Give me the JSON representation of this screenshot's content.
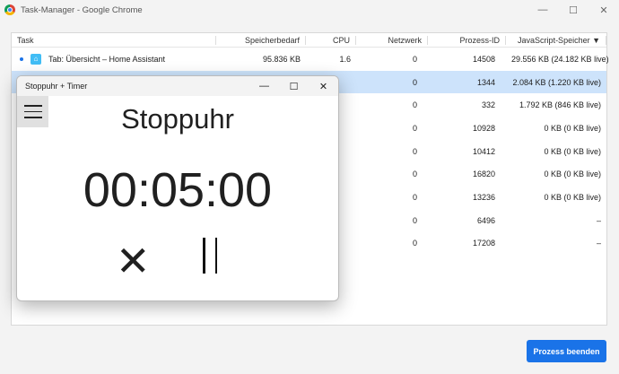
{
  "window": {
    "title": "Task-Manager - Google Chrome",
    "minimize": "—",
    "maximize": "☐",
    "close": "✕"
  },
  "columns": [
    "Task",
    "Speicherbedarf",
    "CPU",
    "Netzwerk",
    "Prozess-ID",
    "JavaScript-Speicher ▼"
  ],
  "rows": [
    {
      "task": "Tab: Übersicht – Home Assistant",
      "mem": "95.836 KB",
      "cpu": "1.6",
      "net": "0",
      "pid": "14508",
      "js": "29.556 KB (24.182 KB live)"
    },
    {
      "task": "",
      "mem": "",
      "cpu": "",
      "net": "0",
      "pid": "1344",
      "js": "2.084 KB (1.220 KB live)"
    },
    {
      "task": "",
      "mem": "",
      "cpu": "",
      "net": "0",
      "pid": "332",
      "js": "1.792 KB (846 KB live)"
    },
    {
      "task": "",
      "mem": "",
      "cpu": "",
      "net": "0",
      "pid": "10928",
      "js": "0 KB (0 KB live)"
    },
    {
      "task": "",
      "mem": "",
      "cpu": "",
      "net": "0",
      "pid": "10412",
      "js": "0 KB (0 KB live)"
    },
    {
      "task": "",
      "mem": "",
      "cpu": "",
      "net": "0",
      "pid": "16820",
      "js": "0 KB (0 KB live)"
    },
    {
      "task": "",
      "mem": "",
      "cpu": "",
      "net": "0",
      "pid": "13236",
      "js": "0 KB (0 KB live)"
    },
    {
      "task": "",
      "mem": "",
      "cpu": "",
      "net": "0",
      "pid": "6496",
      "js": "–"
    },
    {
      "task": "",
      "mem": "",
      "cpu": "",
      "net": "0",
      "pid": "17208",
      "js": "–"
    }
  ],
  "end_button": "Prozess beenden",
  "stopwatch": {
    "window_title": "Stoppuhr + Timer",
    "minimize": "—",
    "maximize": "☐",
    "close": "✕",
    "heading": "Stoppuhr",
    "time": "00:05:00"
  }
}
